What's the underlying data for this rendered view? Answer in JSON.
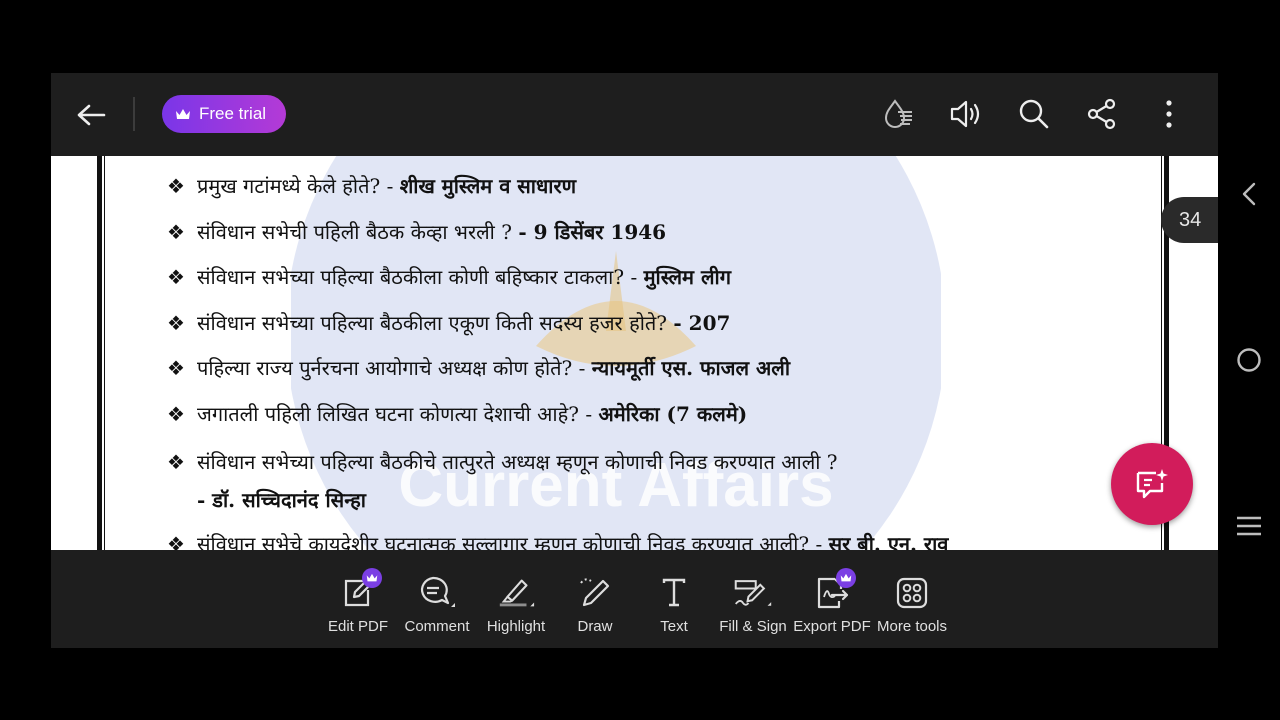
{
  "topbar": {
    "back_icon": "arrow-left-icon",
    "trial_label": "Free trial",
    "icons": [
      "reading-mode-icon",
      "read-aloud-icon",
      "search-icon",
      "share-icon",
      "more-vertical-icon"
    ]
  },
  "document": {
    "questions": [
      {
        "q": "प्रमुख गटांमध्ये केले होते? - ",
        "a": "शीख मुस्लिम व साधारण"
      },
      {
        "q": "संविधान सभेची पहिली बैठक केव्हा भरली ? ",
        "a": "- 9 डिसेंबर 1946"
      },
      {
        "q": "संविधान सभेच्या पहिल्या बैठकीला कोणी बहिष्कार टाकला? - ",
        "a": "मुस्लिम लीग"
      },
      {
        "q": "संविधान सभेच्या पहिल्या बैठकीला एकूण किती सदस्य हजर होते? ",
        "a": "- 207"
      },
      {
        "q": "पहिल्या राज्य पुर्नरचना आयोगाचे अध्यक्ष कोण होते? - ",
        "a": "न्यायमूर्ती एस. फाजल अली"
      },
      {
        "q": "जगातली पहिली लिखित घटना कोणत्या देशाची आहे? - ",
        "a": "अमेरिका (7 कलमे)"
      },
      {
        "q": "संविधान सभेच्या पहिल्या बैठकीचे तात्पुरते अध्यक्ष म्हणून कोणाची निवड करण्यात आली ?",
        "a": ""
      },
      {
        "q": "",
        "a": "- डॉ. सच्चिदानंद सिन्हा"
      },
      {
        "q": "संविधान सभेचे कायदेशीर घटनात्मक सल्लागार म्हणून कोणाची निवड करण्यात आली? - ",
        "a": "सर बी. एन. राव"
      }
    ],
    "bullet": "❖",
    "watermark_text": "Current Affairs"
  },
  "page_number": "34",
  "fab_icon": "ai-assistant-icon",
  "toolbar": {
    "tools": [
      {
        "label": "Edit PDF",
        "icon": "edit-pdf-icon",
        "premium": true
      },
      {
        "label": "Comment",
        "icon": "comment-icon",
        "premium": false
      },
      {
        "label": "Highlight",
        "icon": "highlight-icon",
        "premium": false
      },
      {
        "label": "Draw",
        "icon": "draw-icon",
        "premium": false
      },
      {
        "label": "Text",
        "icon": "text-icon",
        "premium": false
      },
      {
        "label": "Fill & Sign",
        "icon": "fill-sign-icon",
        "premium": false
      },
      {
        "label": "Export PDF",
        "icon": "export-pdf-icon",
        "premium": true
      },
      {
        "label": "More tools",
        "icon": "more-tools-icon",
        "premium": false
      }
    ]
  },
  "system_nav": [
    "back-chevron-icon",
    "home-circle-icon",
    "recents-menu-icon"
  ],
  "colors": {
    "trial_gradient_start": "#7a36e8",
    "trial_gradient_end": "#b43ad6",
    "fab": "#d21c5b",
    "badge": "#7b3fe4"
  }
}
